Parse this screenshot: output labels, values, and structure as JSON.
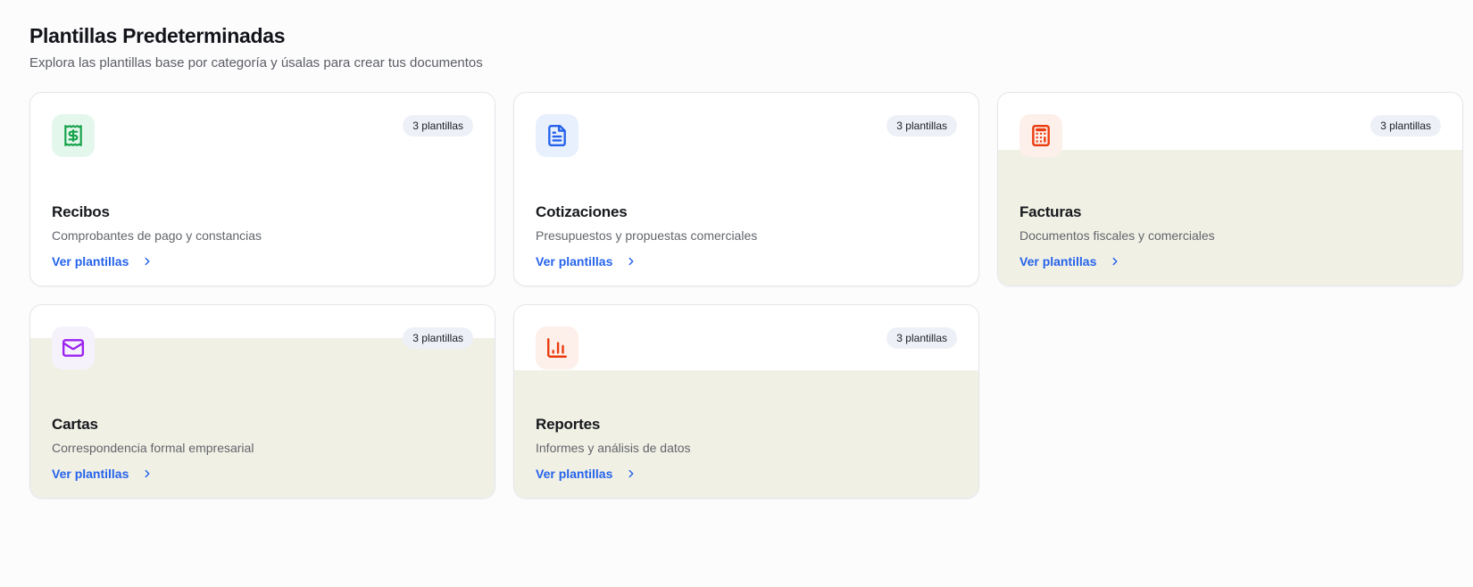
{
  "page": {
    "title": "Plantillas Predeterminadas",
    "subtitle": "Explora las plantillas base por categoría y úsalas para crear tus documentos"
  },
  "colors": {
    "link": "#2563eb",
    "badge_bg": "#edf1f7",
    "card_highlight_fill": "#f1f0e5",
    "page_bg": "#fcfcfd"
  },
  "cards": [
    {
      "title": "Recibos",
      "description": "Comprobantes de pago y constancias",
      "badge": "3 plantillas",
      "link_label": "Ver plantillas",
      "icon": "receipt-icon",
      "icon_color": "#17a24b",
      "icon_bg": "#e4f7ec",
      "highlighted": false
    },
    {
      "title": "Cotizaciones",
      "description": "Presupuestos y propuestas comerciales",
      "badge": "3 plantillas",
      "link_label": "Ver plantillas",
      "icon": "file-text-icon",
      "icon_color": "#2563eb",
      "icon_bg": "#e8effd",
      "highlighted": false
    },
    {
      "title": "Facturas",
      "description": "Documentos fiscales y comerciales",
      "badge": "3 plantillas",
      "link_label": "Ver plantillas",
      "icon": "calculator-icon",
      "icon_color": "#ea3b0d",
      "icon_bg": "#fdefe9",
      "highlighted": true
    },
    {
      "title": "Cartas",
      "description": "Correspondencia formal empresarial",
      "badge": "3 plantillas",
      "link_label": "Ver plantillas",
      "icon": "mail-icon",
      "icon_color": "#9b22f0",
      "icon_bg": "#f6f2fc",
      "highlighted": true
    },
    {
      "title": "Reportes",
      "description": "Informes y análisis de datos",
      "badge": "3 plantillas",
      "link_label": "Ver plantillas",
      "icon": "bar-chart-icon",
      "icon_color": "#ea3b0d",
      "icon_bg": "#fdefe9",
      "highlighted": true
    }
  ]
}
